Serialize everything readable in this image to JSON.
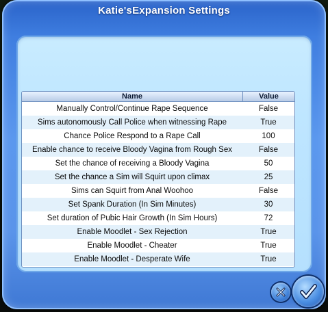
{
  "dialog": {
    "title": "Katie'sExpansion Settings"
  },
  "table": {
    "columns": [
      "Name",
      "Value"
    ],
    "rows": [
      {
        "name": "Manually Control/Continue Rape Sequence",
        "value": "False"
      },
      {
        "name": "Sims autonomously Call Police when witnessing Rape",
        "value": "True"
      },
      {
        "name": "Chance Police Respond to a Rape Call",
        "value": "100"
      },
      {
        "name": "Enable chance to receive Bloody Vagina from Rough Sex",
        "value": "False"
      },
      {
        "name": "Set the chance of receiving a Bloody Vagina",
        "value": "50"
      },
      {
        "name": "Set the chance a Sim will Squirt upon climax",
        "value": "25"
      },
      {
        "name": "Sims can Squirt from Anal Woohoo",
        "value": "False"
      },
      {
        "name": "Set Spank Duration (In Sim Minutes)",
        "value": "30"
      },
      {
        "name": "Set duration of Pubic Hair Growth (In Sim Hours)",
        "value": "72"
      },
      {
        "name": "Enable Moodlet - Sex Rejection",
        "value": "True"
      },
      {
        "name": "Enable Moodlet - Cheater",
        "value": "True"
      },
      {
        "name": "Enable Moodlet - Desperate Wife",
        "value": "True"
      }
    ]
  },
  "buttons": {
    "cancel_icon": "close-icon",
    "ok_icon": "checkmark-icon"
  },
  "colors": {
    "frame": "#5b98ee",
    "panel": "#bfe6ff",
    "row_alt": "#e3f1fb"
  }
}
